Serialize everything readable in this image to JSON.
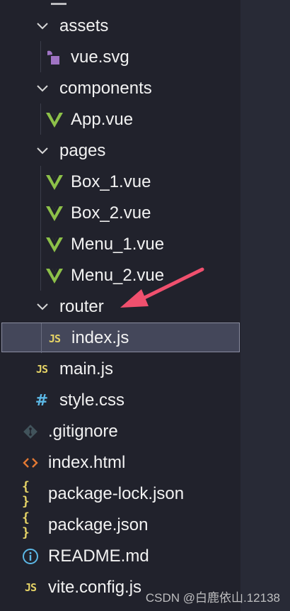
{
  "explorer": {
    "items": [
      {
        "label": "assets",
        "kind": "folder",
        "icon": "chevron-down-icon"
      },
      {
        "label": "vue.svg",
        "kind": "file",
        "icon": "svg-file-icon"
      },
      {
        "label": "components",
        "kind": "folder",
        "icon": "chevron-down-icon"
      },
      {
        "label": "App.vue",
        "kind": "file",
        "icon": "vue-file-icon"
      },
      {
        "label": "pages",
        "kind": "folder",
        "icon": "chevron-down-icon"
      },
      {
        "label": "Box_1.vue",
        "kind": "file",
        "icon": "vue-file-icon"
      },
      {
        "label": "Box_2.vue",
        "kind": "file",
        "icon": "vue-file-icon"
      },
      {
        "label": "Menu_1.vue",
        "kind": "file",
        "icon": "vue-file-icon"
      },
      {
        "label": "Menu_2.vue",
        "kind": "file",
        "icon": "vue-file-icon"
      },
      {
        "label": "router",
        "kind": "folder",
        "icon": "chevron-down-icon"
      },
      {
        "label": "index.js",
        "kind": "file",
        "icon": "js-file-icon",
        "selected": true
      },
      {
        "label": "main.js",
        "kind": "file",
        "icon": "js-file-icon"
      },
      {
        "label": "style.css",
        "kind": "file",
        "icon": "css-file-icon"
      },
      {
        "label": ".gitignore",
        "kind": "file",
        "icon": "git-file-icon"
      },
      {
        "label": "index.html",
        "kind": "file",
        "icon": "html-file-icon"
      },
      {
        "label": "package-lock.json",
        "kind": "file",
        "icon": "json-file-icon"
      },
      {
        "label": "package.json",
        "kind": "file",
        "icon": "json-file-icon"
      },
      {
        "label": "README.md",
        "kind": "file",
        "icon": "info-icon"
      },
      {
        "label": "vite.config.js",
        "kind": "file",
        "icon": "js-file-icon"
      }
    ],
    "glyphs": {
      "js": "JS",
      "css": "#",
      "json": "{ }",
      "html": "<>",
      "info": "i"
    }
  },
  "annotation": {
    "arrow_color": "#f0506e",
    "icon": "red-arrow-icon"
  },
  "watermark": "CSDN @白鹿依山.12138",
  "colors": {
    "background": "#21222c",
    "selection": "#44475a",
    "vue": "#8dc149",
    "js": "#e5d366",
    "css": "#5cb8e6",
    "html": "#e37933",
    "info": "#5cb8e6"
  }
}
